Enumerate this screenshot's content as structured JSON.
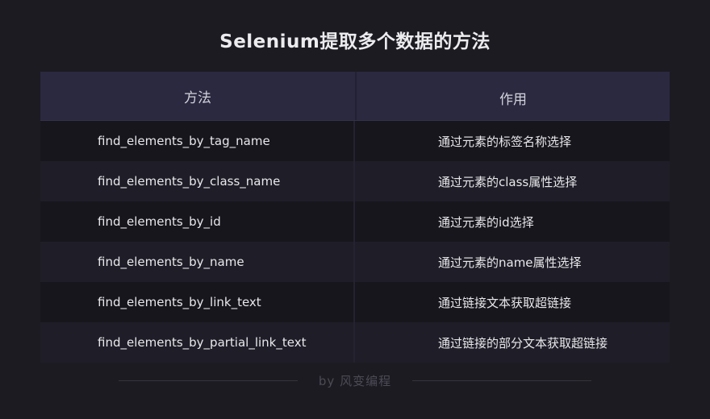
{
  "title": "Selenium提取多个数据的方法",
  "table": {
    "headers": [
      "方法",
      "作用"
    ],
    "rows": [
      {
        "method": "find_elements_by_tag_name",
        "purpose": "通过元素的标签名称选择"
      },
      {
        "method": "find_elements_by_class_name",
        "purpose": "通过元素的class属性选择"
      },
      {
        "method": "find_elements_by_id",
        "purpose": "通过元素的id选择"
      },
      {
        "method": "find_elements_by_name",
        "purpose": "通过元素的name属性选择"
      },
      {
        "method": "find_elements_by_link_text",
        "purpose": "通过链接文本获取超链接"
      },
      {
        "method": "find_elements_by_partial_link_text",
        "purpose": "通过链接的部分文本获取超链接"
      }
    ]
  },
  "footer": {
    "credit": "by 风变编程"
  },
  "colors": {
    "background": "#1c1b21",
    "header_bg": "#2a2940",
    "row_dark": "#17161c",
    "row_light": "#1f1e28"
  }
}
